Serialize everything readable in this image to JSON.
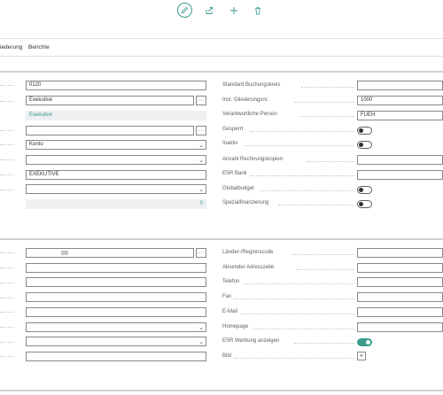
{
  "toolbar": {
    "edit_icon": "pencil-icon",
    "share_icon": "share-icon",
    "new_icon": "plus-icon",
    "delete_icon": "trash-icon",
    "accent": "#3a9b8c"
  },
  "menu": {
    "item1": "iederung",
    "item2": "Berichte"
  },
  "general": {
    "left_fields": {
      "code": "0120",
      "name": "Exekutive",
      "name_display": "Exekutive",
      "field4": "",
      "type": "Konto",
      "field6": "",
      "upper_name": "EXEKUTIVE",
      "field8": "",
      "count": "0"
    },
    "right": {
      "label1": "Standard Buchungskreis",
      "value1": "",
      "label2": "Inst. Gliederungsnr.",
      "value2": "1000",
      "label3": "Verantwortliche Person",
      "value3": "FUEH",
      "label4": "Gesperrt",
      "toggle4": false,
      "label5": "Inaktiv",
      "toggle5": false,
      "label6": "Anzahl Rechnungskopien",
      "value6": "",
      "label7": "ESR Bank",
      "value7": "",
      "label8": "Globalbudget",
      "toggle8": false,
      "label9": "Spezialfinanzierung",
      "toggle9": false
    }
  },
  "communication": {
    "right": {
      "label1": "Länder-/Regionscode",
      "label2": "Absender Adresszeile",
      "label3": "Telefon",
      "label4": "Fax",
      "label5": "E-Mail",
      "label6": "Homepage",
      "label7": "ESR Werbung anzeigen",
      "toggle7": true,
      "label8": "Bild"
    }
  }
}
